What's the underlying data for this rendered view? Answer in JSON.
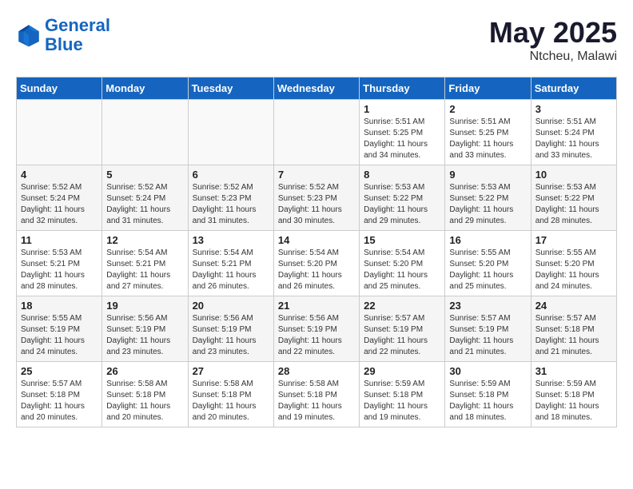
{
  "header": {
    "logo_line1": "General",
    "logo_line2": "Blue",
    "month": "May 2025",
    "location": "Ntcheu, Malawi"
  },
  "weekdays": [
    "Sunday",
    "Monday",
    "Tuesday",
    "Wednesday",
    "Thursday",
    "Friday",
    "Saturday"
  ],
  "weeks": [
    [
      {
        "day": "",
        "empty": true
      },
      {
        "day": "",
        "empty": true
      },
      {
        "day": "",
        "empty": true
      },
      {
        "day": "",
        "empty": true
      },
      {
        "day": "1",
        "sunrise": "5:51 AM",
        "sunset": "5:25 PM",
        "daylight": "11 hours and 34 minutes."
      },
      {
        "day": "2",
        "sunrise": "5:51 AM",
        "sunset": "5:25 PM",
        "daylight": "11 hours and 33 minutes."
      },
      {
        "day": "3",
        "sunrise": "5:51 AM",
        "sunset": "5:24 PM",
        "daylight": "11 hours and 33 minutes."
      }
    ],
    [
      {
        "day": "4",
        "sunrise": "5:52 AM",
        "sunset": "5:24 PM",
        "daylight": "11 hours and 32 minutes."
      },
      {
        "day": "5",
        "sunrise": "5:52 AM",
        "sunset": "5:24 PM",
        "daylight": "11 hours and 31 minutes."
      },
      {
        "day": "6",
        "sunrise": "5:52 AM",
        "sunset": "5:23 PM",
        "daylight": "11 hours and 31 minutes."
      },
      {
        "day": "7",
        "sunrise": "5:52 AM",
        "sunset": "5:23 PM",
        "daylight": "11 hours and 30 minutes."
      },
      {
        "day": "8",
        "sunrise": "5:53 AM",
        "sunset": "5:22 PM",
        "daylight": "11 hours and 29 minutes."
      },
      {
        "day": "9",
        "sunrise": "5:53 AM",
        "sunset": "5:22 PM",
        "daylight": "11 hours and 29 minutes."
      },
      {
        "day": "10",
        "sunrise": "5:53 AM",
        "sunset": "5:22 PM",
        "daylight": "11 hours and 28 minutes."
      }
    ],
    [
      {
        "day": "11",
        "sunrise": "5:53 AM",
        "sunset": "5:21 PM",
        "daylight": "11 hours and 28 minutes."
      },
      {
        "day": "12",
        "sunrise": "5:54 AM",
        "sunset": "5:21 PM",
        "daylight": "11 hours and 27 minutes."
      },
      {
        "day": "13",
        "sunrise": "5:54 AM",
        "sunset": "5:21 PM",
        "daylight": "11 hours and 26 minutes."
      },
      {
        "day": "14",
        "sunrise": "5:54 AM",
        "sunset": "5:20 PM",
        "daylight": "11 hours and 26 minutes."
      },
      {
        "day": "15",
        "sunrise": "5:54 AM",
        "sunset": "5:20 PM",
        "daylight": "11 hours and 25 minutes."
      },
      {
        "day": "16",
        "sunrise": "5:55 AM",
        "sunset": "5:20 PM",
        "daylight": "11 hours and 25 minutes."
      },
      {
        "day": "17",
        "sunrise": "5:55 AM",
        "sunset": "5:20 PM",
        "daylight": "11 hours and 24 minutes."
      }
    ],
    [
      {
        "day": "18",
        "sunrise": "5:55 AM",
        "sunset": "5:19 PM",
        "daylight": "11 hours and 24 minutes."
      },
      {
        "day": "19",
        "sunrise": "5:56 AM",
        "sunset": "5:19 PM",
        "daylight": "11 hours and 23 minutes."
      },
      {
        "day": "20",
        "sunrise": "5:56 AM",
        "sunset": "5:19 PM",
        "daylight": "11 hours and 23 minutes."
      },
      {
        "day": "21",
        "sunrise": "5:56 AM",
        "sunset": "5:19 PM",
        "daylight": "11 hours and 22 minutes."
      },
      {
        "day": "22",
        "sunrise": "5:57 AM",
        "sunset": "5:19 PM",
        "daylight": "11 hours and 22 minutes."
      },
      {
        "day": "23",
        "sunrise": "5:57 AM",
        "sunset": "5:19 PM",
        "daylight": "11 hours and 21 minutes."
      },
      {
        "day": "24",
        "sunrise": "5:57 AM",
        "sunset": "5:18 PM",
        "daylight": "11 hours and 21 minutes."
      }
    ],
    [
      {
        "day": "25",
        "sunrise": "5:57 AM",
        "sunset": "5:18 PM",
        "daylight": "11 hours and 20 minutes."
      },
      {
        "day": "26",
        "sunrise": "5:58 AM",
        "sunset": "5:18 PM",
        "daylight": "11 hours and 20 minutes."
      },
      {
        "day": "27",
        "sunrise": "5:58 AM",
        "sunset": "5:18 PM",
        "daylight": "11 hours and 20 minutes."
      },
      {
        "day": "28",
        "sunrise": "5:58 AM",
        "sunset": "5:18 PM",
        "daylight": "11 hours and 19 minutes."
      },
      {
        "day": "29",
        "sunrise": "5:59 AM",
        "sunset": "5:18 PM",
        "daylight": "11 hours and 19 minutes."
      },
      {
        "day": "30",
        "sunrise": "5:59 AM",
        "sunset": "5:18 PM",
        "daylight": "11 hours and 18 minutes."
      },
      {
        "day": "31",
        "sunrise": "5:59 AM",
        "sunset": "5:18 PM",
        "daylight": "11 hours and 18 minutes."
      }
    ]
  ]
}
